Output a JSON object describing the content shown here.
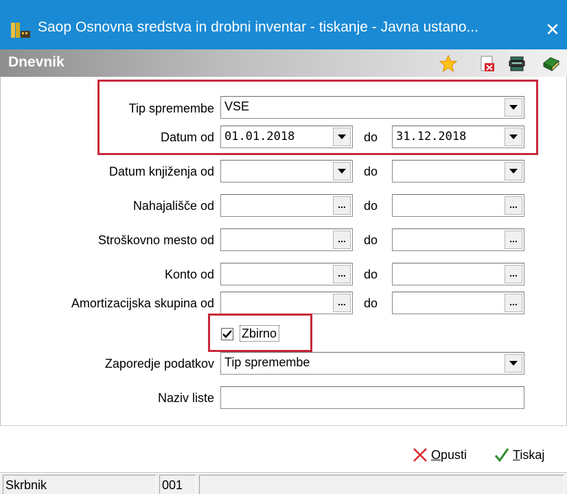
{
  "window": {
    "title": "Saop Osnovna sredstva in drobni inventar - tiskanje - Javna ustano...",
    "close_label": "✕"
  },
  "section": {
    "title": "Dnevnik",
    "icons": [
      "star-icon",
      "pdf-export-icon",
      "printer-stack-icon",
      "book-icon"
    ]
  },
  "form": {
    "do_label": "do",
    "tip_spremembe": {
      "label": "Tip spremembe",
      "value": "VSE"
    },
    "datum": {
      "label": "Datum od",
      "from": "01.01.2018",
      "to": "31.12.2018"
    },
    "datum_knjizenja": {
      "label": "Datum knjiženja od",
      "from": "",
      "to": ""
    },
    "nahajalisce": {
      "label": "Nahajališče od",
      "from": "",
      "to": ""
    },
    "stroskovno_mesto": {
      "label": "Stroškovno mesto od",
      "from": "",
      "to": ""
    },
    "konto": {
      "label": "Konto od",
      "from": "",
      "to": ""
    },
    "amortizacijska_skupina": {
      "label": "Amortizacijska skupina od",
      "from": "",
      "to": ""
    },
    "zbirno": {
      "label": "Zbirno",
      "checked": true
    },
    "zaporedje": {
      "label": "Zaporedje podatkov",
      "value": "Tip spremembe"
    },
    "naziv_liste": {
      "label": "Naziv liste",
      "value": ""
    },
    "ellipsis": "..."
  },
  "buttons": {
    "opusti_first": "O",
    "opusti_rest": "pusti",
    "tiskaj_first": "T",
    "tiskaj_rest": "iskaj"
  },
  "status": {
    "user": "Skrbnik",
    "code": "001",
    "extra": ""
  },
  "colors": {
    "titlebar": "#1a8ad4",
    "highlight": "#c8283a",
    "cancel": "#d9262e",
    "confirm": "#2e8b2e"
  }
}
